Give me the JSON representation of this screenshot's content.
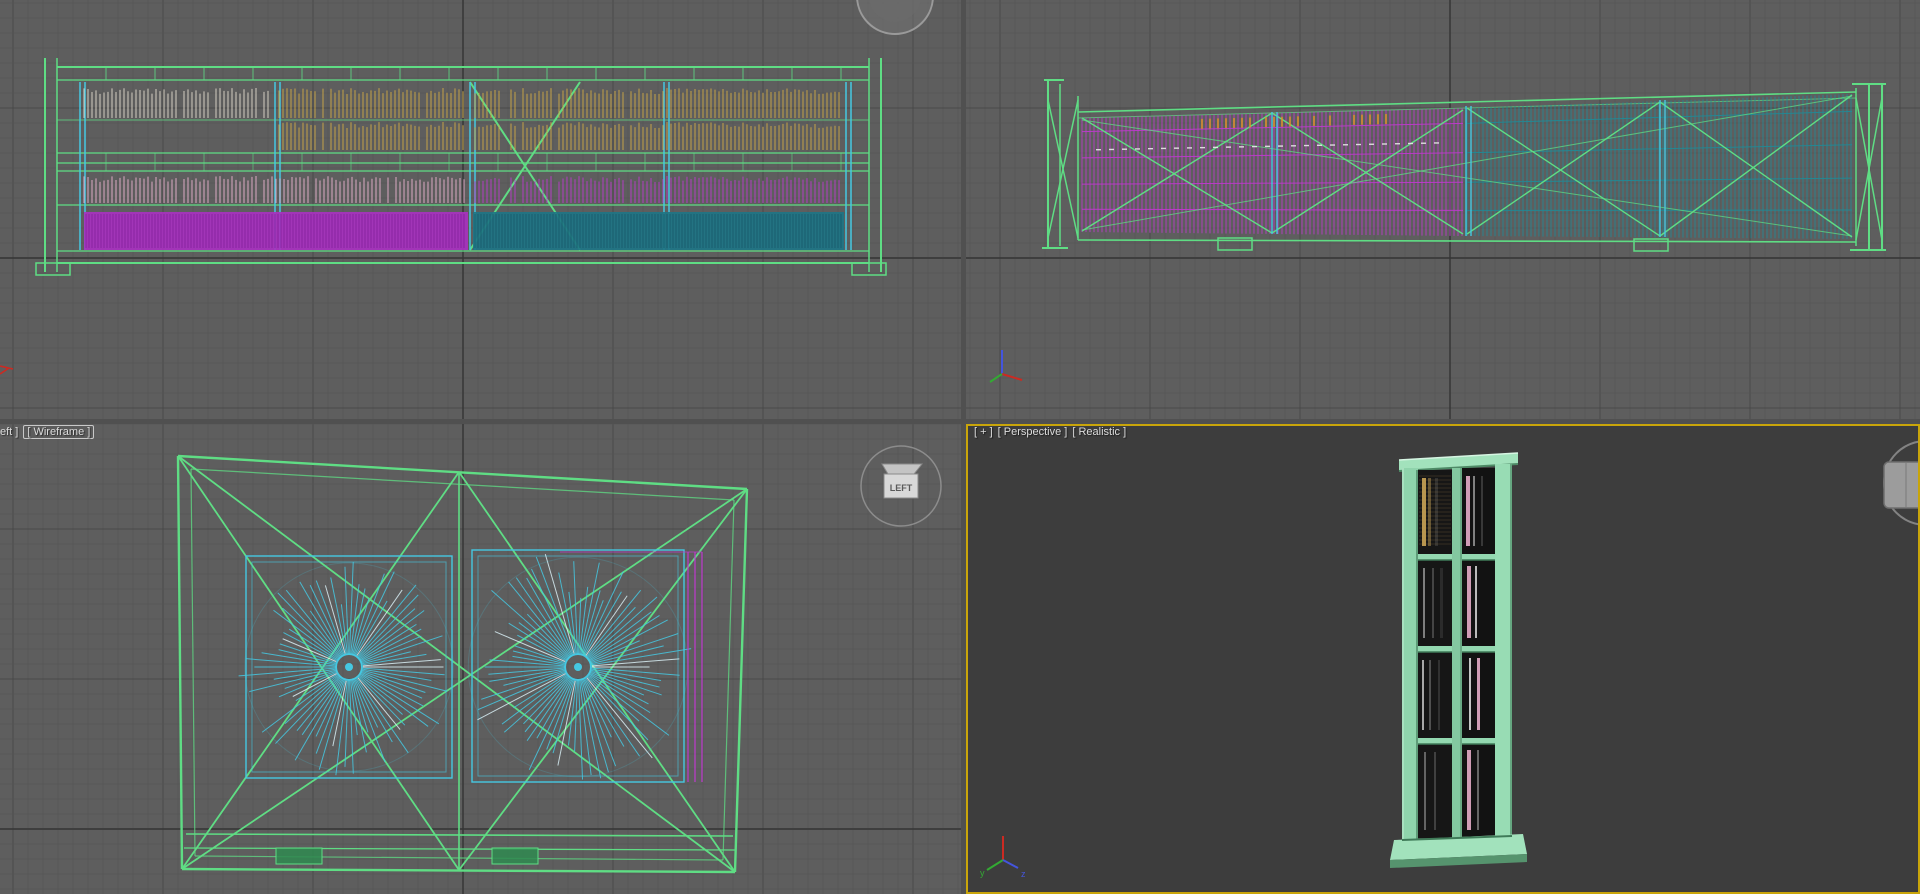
{
  "colors": {
    "canvas_bg": "#505050",
    "viewport_bg": "#5e5e5e",
    "perspective_bg": "#3d3d3d",
    "grid_minor": "#545454",
    "grid_major": "#494949",
    "grid_axis": "#343434",
    "active_border": "#c9a50a",
    "label_text": "#dcdcdc",
    "wire_green": "#5fdd84",
    "wire_cyan": "#45c8e2",
    "wire_magenta": "#c238d2",
    "wire_pink": "#f2b6d6",
    "wire_yellow": "#d6ae44",
    "wire_cream": "#e9e2d2",
    "wire_teal": "#1f8b97",
    "band_magenta": "#a832c0",
    "band_teal": "#1e7586",
    "tick_orange": "#e0922a",
    "solid_green_light": "#a2e2bc",
    "solid_green_mid": "#8fd4ac",
    "solid_green_dark": "#4e8a66",
    "axis_x_red": "#cc2a22",
    "axis_y_green": "#33aa33",
    "axis_z_blue": "#4455dd",
    "viewcube_gray": "#9c9c9c"
  },
  "labels": {
    "bottom_left_view": "eft ]",
    "bottom_left_shading": "[ Wireframe ]",
    "br_plus": "[ + ]",
    "br_view": "[ Perspective ]",
    "br_shading": "[ Realistic ]"
  },
  "viewcube": {
    "face": "LEFT"
  },
  "axis_gizmo": {
    "y": "y",
    "z": "z"
  }
}
